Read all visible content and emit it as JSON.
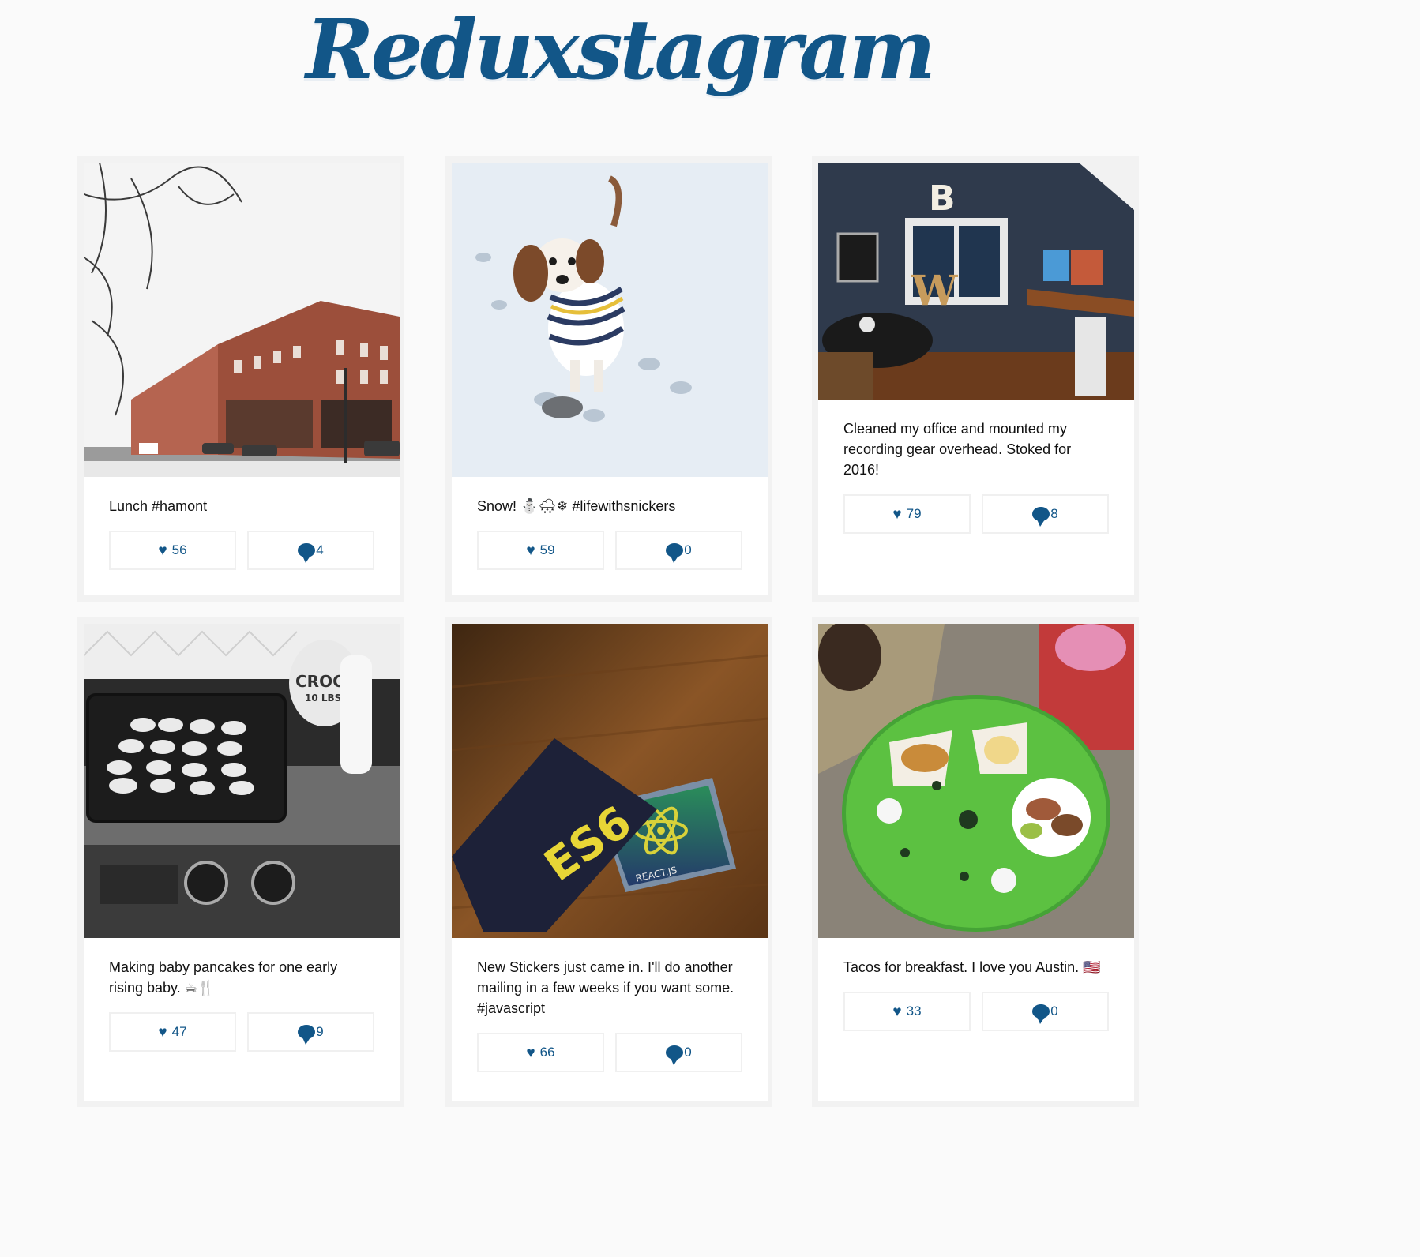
{
  "header": {
    "title": "Reduxstagram"
  },
  "posts": [
    {
      "caption": "Lunch #hamont",
      "likes": "56",
      "comments": "4",
      "photo_icon": "street-photo-icon"
    },
    {
      "caption": "Snow! ⛄🌨❄ #lifewithsnickers",
      "likes": "59",
      "comments": "0",
      "photo_icon": "dog-photo-icon"
    },
    {
      "caption": "Cleaned my office and mounted my recording gear overhead. Stoked for 2016!",
      "likes": "79",
      "comments": "8",
      "photo_icon": "office-photo-icon"
    },
    {
      "caption": "Making baby pancakes for one early rising baby. ☕🍴",
      "likes": "47",
      "comments": "9",
      "photo_icon": "pancakes-photo-icon"
    },
    {
      "caption": "New Stickers just came in. I'll do another mailing in a few weeks if you want some. #javascript",
      "likes": "66",
      "comments": "0",
      "photo_icon": "stickers-photo-icon"
    },
    {
      "caption": "Tacos for breakfast. I love you Austin. 🇺🇸",
      "likes": "33",
      "comments": "0",
      "photo_icon": "tacos-photo-icon"
    }
  ],
  "sticker_text": {
    "es6": "ES6",
    "react": "REACT.JS"
  },
  "crock_text": {
    "line1": "CROCK",
    "line2": "10 LBS."
  },
  "colors": {
    "brand": "#125688",
    "background": "#fafafa",
    "card": "#ffffff"
  }
}
